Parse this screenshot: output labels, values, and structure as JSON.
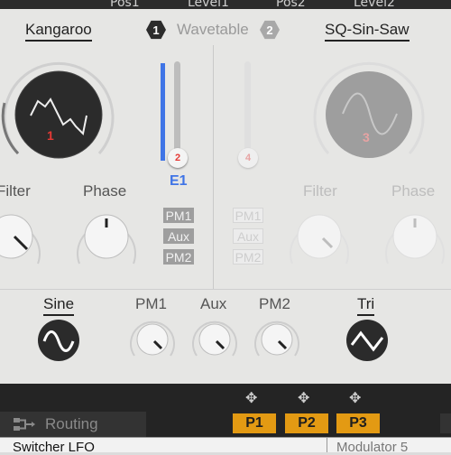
{
  "top_bar": {
    "labels": [
      "Pos1",
      "Level1",
      "Pos2",
      "Level2"
    ]
  },
  "osc1": {
    "name": "Kangaroo",
    "number": "1",
    "filter_label": "Filter",
    "phase_label": "Phase"
  },
  "wavetable": {
    "badge1": "1",
    "title": "Wavetable",
    "badge2": "2"
  },
  "osc2": {
    "name": "SQ-Sin-Saw",
    "number": "3",
    "filter_label": "Filter",
    "phase_label": "Phase"
  },
  "slider1": {
    "badge": "2",
    "label": "E1",
    "level": 0.8,
    "color": "#3f74e6"
  },
  "slider2": {
    "badge": "4"
  },
  "mod_buttons_left": [
    "PM1",
    "Aux",
    "PM2"
  ],
  "mod_buttons_right": [
    "PM1",
    "Aux",
    "PM2"
  ],
  "lfo_left": {
    "label": "Sine"
  },
  "lfo_knobs": [
    "PM1",
    "Aux",
    "PM2"
  ],
  "lfo_right": {
    "label": "Tri"
  },
  "routing": {
    "label": "Routing"
  },
  "pads": [
    "P1",
    "P2",
    "P3"
  ],
  "lower": {
    "left": "Switcher LFO",
    "right": "Modulator 5"
  },
  "colors": {
    "accent_blue": "#3f74e6",
    "marker_red": "#e53935",
    "pad_orange": "#e39a13"
  }
}
